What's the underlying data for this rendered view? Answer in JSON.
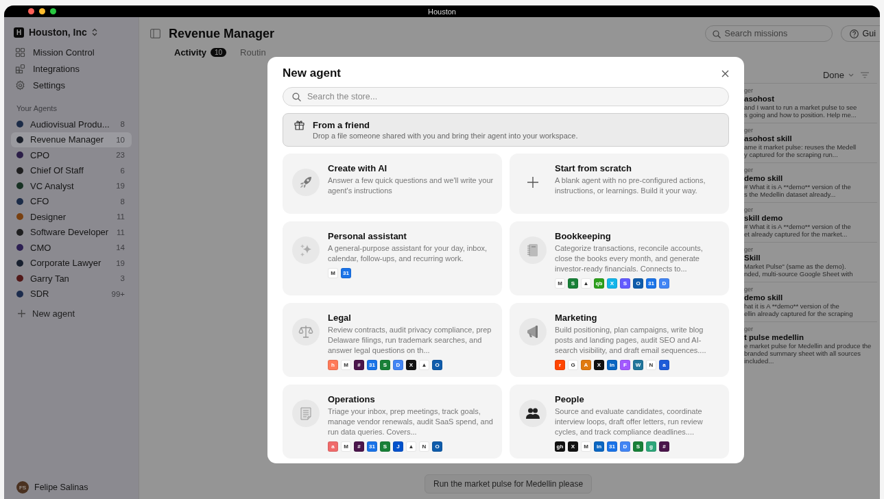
{
  "window": {
    "title": "Houston"
  },
  "sidebar": {
    "org": {
      "initial": "H",
      "name": "Houston, Inc"
    },
    "nav": [
      {
        "label": "Mission Control"
      },
      {
        "label": "Integrations"
      },
      {
        "label": "Settings"
      }
    ],
    "section_title": "Your Agents",
    "agents": [
      {
        "name": "Audiovisual Produ...",
        "count": "8",
        "color": "#1c2c48",
        "selected": false
      },
      {
        "name": "Revenue Manager",
        "count": "10",
        "color": "#1a1f2a",
        "selected": true
      },
      {
        "name": "CPO",
        "count": "23",
        "color": "#2c1f48",
        "selected": false
      },
      {
        "name": "Chief Of Staff",
        "count": "6",
        "color": "#1f1f20",
        "selected": false
      },
      {
        "name": "VC Analyst",
        "count": "19",
        "color": "#173123",
        "selected": false
      },
      {
        "name": "CFO",
        "count": "8",
        "color": "#1c2c48",
        "selected": false
      },
      {
        "name": "Designer",
        "count": "11",
        "color": "#784010",
        "selected": false
      },
      {
        "name": "Software Developer",
        "count": "11",
        "color": "#1f1f20",
        "selected": false
      },
      {
        "name": "CMO",
        "count": "14",
        "color": "#2c1f52",
        "selected": false
      },
      {
        "name": "Corporate Lawyer",
        "count": "19",
        "color": "#18202f",
        "selected": false
      },
      {
        "name": "Garry Tan",
        "count": "3",
        "color": "#521919",
        "selected": false
      },
      {
        "name": "SDR",
        "count": "99+",
        "color": "#1c2c4d",
        "selected": false
      }
    ],
    "new_agent": "New agent",
    "user": {
      "initials": "FS",
      "name": "Felipe Salinas"
    }
  },
  "header": {
    "title": "Revenue Manager",
    "search": {
      "placeholder": "Search missions"
    },
    "guide_button": "Gui"
  },
  "tabs": [
    {
      "label": "Activity",
      "count": "10",
      "selected": true
    },
    {
      "label": "Routin",
      "selected": false
    }
  ],
  "filter": {
    "label": "Done"
  },
  "activity": [
    {
      "role": "ger",
      "title": "asohost",
      "lines": [
        "and I want to run a market pulse to see",
        "s going and how to position. Help me..."
      ]
    },
    {
      "role": "ger",
      "title": "asohost skill",
      "lines": [
        "ame it market pulse: reuses the Medell",
        "y captured for the scraping run..."
      ]
    },
    {
      "role": "ger",
      "title": "demo skill",
      "lines": [
        "# What it is A **demo** version of the",
        "s the Medellin dataset already..."
      ]
    },
    {
      "role": "ger",
      "title": "skill demo",
      "lines": [
        "# What it is A **demo** version of the",
        "et already captured for the market..."
      ]
    },
    {
      "role": "ger",
      "title": "Skill",
      "lines": [
        "Market Pulse\" (same as the demo).",
        "nded, multi-source Google Sheet with"
      ]
    },
    {
      "role": "ger",
      "title": "demo skill",
      "lines": [
        "hat it is A **demo** version of the",
        "ellin already captured for the scraping"
      ]
    },
    {
      "role": "ger",
      "title": "t pulse medellin",
      "lines": [
        "e market pulse for Medellin and produce the",
        "branded summary sheet with all sources included..."
      ]
    }
  ],
  "message": "Run the market pulse for Medellin please",
  "modal": {
    "title": "New agent",
    "search": {
      "placeholder": "Search the store..."
    },
    "friend": {
      "title": "From a friend",
      "description": "Drop a file someone shared with you and bring their agent into your workspace."
    },
    "cards": [
      {
        "title": "Create with AI",
        "description": "Answer a few quick questions and we'll write your agent's instructions"
      },
      {
        "title": "Start from scratch",
        "description": "A blank agent with no pre-configured actions, instructions, or learnings. Build it your way."
      },
      {
        "title": "Personal assistant",
        "description": "A general-purpose assistant for your day, inbox, calendar, follow-ups, and recurring work.",
        "badges": [
          {
            "label": "M",
            "color": "#ffffff"
          },
          {
            "label": "31",
            "color": "#1a73e8"
          }
        ]
      },
      {
        "title": "Bookkeeping",
        "description": "Categorize transactions, reconcile accounts, close the books every month, and generate investor-ready financials. Connects to...",
        "badges": [
          {
            "label": "M",
            "color": "#ffffff"
          },
          {
            "label": "S",
            "color": "#188038"
          },
          {
            "label": "▲",
            "color": "#ffffff"
          },
          {
            "label": "qb",
            "color": "#2ca01c"
          },
          {
            "label": "X",
            "color": "#13b5ea"
          },
          {
            "label": "S",
            "color": "#635bff"
          },
          {
            "label": "O",
            "color": "#0f5cab"
          },
          {
            "label": "31",
            "color": "#1a73e8"
          },
          {
            "label": "D",
            "color": "#4285f4"
          }
        ]
      },
      {
        "title": "Legal",
        "description": "Review contracts, audit privacy compliance, prep Delaware filings, run trademark searches, and answer legal questions on th...",
        "badges": [
          {
            "label": "h",
            "color": "#ff7a59"
          },
          {
            "label": "M",
            "color": "#ffffff"
          },
          {
            "label": "#",
            "color": "#4a154b"
          },
          {
            "label": "31",
            "color": "#1a73e8"
          },
          {
            "label": "S",
            "color": "#188038"
          },
          {
            "label": "D",
            "color": "#4285f4"
          },
          {
            "label": "X",
            "color": "#111111"
          },
          {
            "label": "▲",
            "color": "#ffffff"
          },
          {
            "label": "O",
            "color": "#0f5cab"
          }
        ]
      },
      {
        "title": "Marketing",
        "description": "Build positioning, plan campaigns, write blog posts and landing pages, audit SEO and AI-search visibility, and draft email sequences....",
        "badges": [
          {
            "label": "r",
            "color": "#ff4500"
          },
          {
            "label": "G",
            "color": "#ffffff"
          },
          {
            "label": "A",
            "color": "#e07a10"
          },
          {
            "label": "X",
            "color": "#111111"
          },
          {
            "label": "in",
            "color": "#0a66c2"
          },
          {
            "label": "F",
            "color": "#a259ff"
          },
          {
            "label": "W",
            "color": "#21759b"
          },
          {
            "label": "N",
            "color": "#ffffff"
          },
          {
            "label": "a",
            "color": "#1e5bd8"
          }
        ]
      },
      {
        "title": "Operations",
        "description": "Triage your inbox, prep meetings, track goals, manage vendor renewals, audit SaaS spend, and run data queries. Covers...",
        "badges": [
          {
            "label": "a",
            "color": "#f06a6a"
          },
          {
            "label": "M",
            "color": "#ffffff"
          },
          {
            "label": "#",
            "color": "#4a154b"
          },
          {
            "label": "31",
            "color": "#1a73e8"
          },
          {
            "label": "S",
            "color": "#188038"
          },
          {
            "label": "J",
            "color": "#0052cc"
          },
          {
            "label": "▲",
            "color": "#ffffff"
          },
          {
            "label": "N",
            "color": "#ffffff"
          },
          {
            "label": "O",
            "color": "#0f5cab"
          }
        ]
      },
      {
        "title": "People",
        "description": "Source and evaluate candidates, coordinate interview loops, draft offer letters, run review cycles, and track compliance deadlines....",
        "badges": [
          {
            "label": "gh",
            "color": "#111111"
          },
          {
            "label": "X",
            "color": "#111111"
          },
          {
            "label": "M",
            "color": "#ffffff"
          },
          {
            "label": "in",
            "color": "#0a66c2"
          },
          {
            "label": "31",
            "color": "#1a73e8"
          },
          {
            "label": "D",
            "color": "#4285f4"
          },
          {
            "label": "S",
            "color": "#188038"
          },
          {
            "label": "g",
            "color": "#2ea67a"
          },
          {
            "label": "#",
            "color": "#4a154b"
          }
        ]
      }
    ]
  }
}
